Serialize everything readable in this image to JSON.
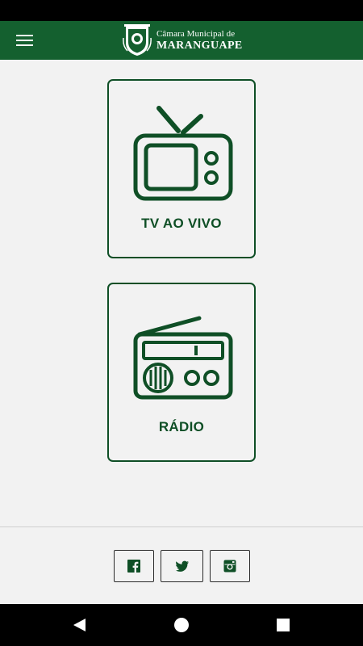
{
  "header": {
    "brand_line1": "Câmara Municipal de",
    "brand_line2": "MARANGUAPE",
    "menu_icon": "hamburger-menu-icon",
    "logo_icon": "city-crest-logo"
  },
  "cards": [
    {
      "label": "TV AO VIVO",
      "icon": "tv-icon"
    },
    {
      "label": "RÁDIO",
      "icon": "radio-icon"
    }
  ],
  "social": [
    {
      "icon": "facebook-icon"
    },
    {
      "icon": "twitter-icon"
    },
    {
      "icon": "instagram-icon"
    }
  ],
  "nav": {
    "back_icon": "back-triangle-icon",
    "home_icon": "home-circle-icon",
    "recent_icon": "recent-square-icon"
  },
  "colors": {
    "brand_green": "#14602f",
    "card_border": "#0f4f26",
    "background": "#f2f2f2"
  }
}
